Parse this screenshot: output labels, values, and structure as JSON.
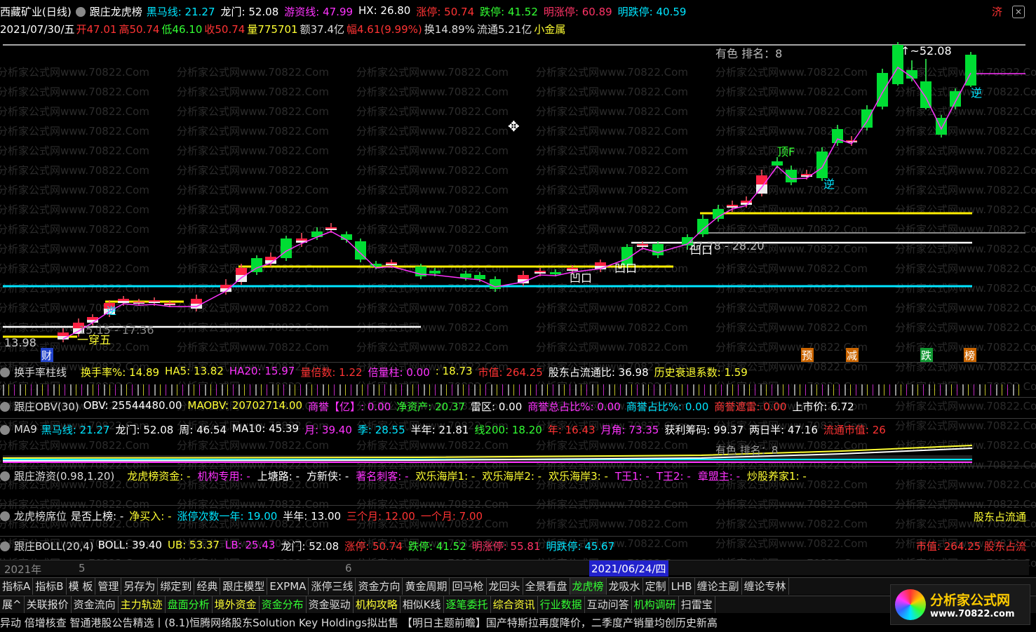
{
  "header": {
    "stock": "西藏矿业(日线)",
    "indicator": "跟庄龙虎榜",
    "items": [
      {
        "t": "黑马线: 21.27",
        "c": "#00e5ff"
      },
      {
        "t": "龙门: 52.08",
        "c": "#ffffff"
      },
      {
        "t": "游资线: 47.99",
        "c": "#ff33ff"
      },
      {
        "t": "HX: 26.80",
        "c": "#ffffff"
      },
      {
        "t": "涨停: 50.74",
        "c": "#ff3333"
      },
      {
        "t": "跌停: 41.52",
        "c": "#33ff33"
      },
      {
        "t": "明涨停: 60.89",
        "c": "#ff3366"
      },
      {
        "t": "明跌停: 40.59",
        "c": "#00e5ff"
      }
    ],
    "corner": "济"
  },
  "info": {
    "date": "2021/07/30/五",
    "items": [
      {
        "t": "开47.01",
        "c": "#ff3333"
      },
      {
        "t": "高50.74",
        "c": "#ff3333"
      },
      {
        "t": "低46.10",
        "c": "#33ff33"
      },
      {
        "t": "收50.74",
        "c": "#ff3333"
      },
      {
        "t": "量775701",
        "c": "#ffff33"
      },
      {
        "t": "额37.4亿",
        "c": "#dddddd"
      },
      {
        "t": "幅4.61(9.99%)",
        "c": "#ff3333"
      },
      {
        "t": "换14.89%",
        "c": "#dddddd"
      },
      {
        "t": "流通5.21亿",
        "c": "#dddddd"
      },
      {
        "t": "小金属",
        "c": "#ffff33"
      }
    ]
  },
  "watermark": "分析家公式网www.70822.Com",
  "chart_labels": {
    "peak": "52.08",
    "rank": "有色    排名：8",
    "range1": "27.78 - 28.20",
    "range2": "15.15 - 17.36",
    "low": "13.98",
    "chuan": "一穿五",
    "top": "顶F",
    "ni1": "逆",
    "ni2": "逆",
    "ni3": "逆",
    "ao1": "凹口",
    "ao2": "凹口",
    "ao3": "凹口",
    "sig_cai": "财",
    "sig_yu": "预",
    "sig_jian": "减",
    "sig_die": "跌",
    "sig_bang": "榜"
  },
  "rows": {
    "turnover": {
      "name": "换手率柱线",
      "items": [
        {
          "t": "换手率%: 14.89",
          "c": "#ffff33"
        },
        {
          "t": "HA5: 13.82",
          "c": "#ffff33"
        },
        {
          "t": "HA20: 15.97",
          "c": "#ff33ff"
        },
        {
          "t": "量倍数: 1.22",
          "c": "#ff3333"
        },
        {
          "t": "倍量柱: 0.00",
          "c": "#ff33ff"
        },
        {
          "t": ": 18.73",
          "c": "#ffff33"
        },
        {
          "t": "市值: 264.25",
          "c": "#ff3333"
        },
        {
          "t": "股东占流通比: 36.98",
          "c": "#ffffff"
        },
        {
          "t": "历史衰退系数: 1.59",
          "c": "#ffff33"
        }
      ]
    },
    "obv": {
      "name": "跟庄OBV(30)",
      "items": [
        {
          "t": "OBV: 25544480.00",
          "c": "#ffffff"
        },
        {
          "t": "MAOBV: 20702714.00",
          "c": "#ffff33"
        },
        {
          "t": "商誉【亿】: 0.00",
          "c": "#ff33ff"
        },
        {
          "t": "净资产: 20.37",
          "c": "#33ff33"
        },
        {
          "t": "雷区: 0.00",
          "c": "#ffffff"
        },
        {
          "t": "商誉总占比%: 0.00",
          "c": "#ff33ff"
        },
        {
          "t": "商誉占比%: 0.00",
          "c": "#00e5ff"
        },
        {
          "t": "商誉遮雷: 0.00",
          "c": "#ff3333"
        },
        {
          "t": "上市价: 6.72",
          "c": "#ffffff"
        }
      ]
    },
    "ma9": {
      "name": "MA9",
      "items": [
        {
          "t": "黑马线: 21.27",
          "c": "#00e5ff"
        },
        {
          "t": "龙门: 52.08",
          "c": "#ffffff"
        },
        {
          "t": "周: 46.54",
          "c": "#ffffff"
        },
        {
          "t": "MA10: 45.39",
          "c": "#ffffff"
        },
        {
          "t": "月: 39.40",
          "c": "#ff33ff"
        },
        {
          "t": "季: 28.55",
          "c": "#00e5ff"
        },
        {
          "t": "半年: 21.81",
          "c": "#ffffff"
        },
        {
          "t": "线200: 18.20",
          "c": "#33ff33"
        },
        {
          "t": "年: 16.43",
          "c": "#ff3333"
        },
        {
          "t": "月角: 73.35",
          "c": "#ff33ff"
        },
        {
          "t": "获利筹码: 99.37",
          "c": "#ffffff"
        },
        {
          "t": "两日半: 47.16",
          "c": "#ffffff"
        },
        {
          "t": "流通市值: 26",
          "c": "#ff3333"
        }
      ]
    },
    "youzi": {
      "name": "跟庄游资(0.98,1.20)",
      "items": [
        {
          "t": "龙虎榜资金: -",
          "c": "#ffff33"
        },
        {
          "t": "机构专用: -",
          "c": "#ff33ff"
        },
        {
          "t": "上塘路: -",
          "c": "#ffffff"
        },
        {
          "t": "方新侠: -",
          "c": "#ffffff"
        },
        {
          "t": "著名刺客: -",
          "c": "#ff33ff"
        },
        {
          "t": "欢乐海岸1: -",
          "c": "#ffff33"
        },
        {
          "t": "欢乐海岸2: -",
          "c": "#ffff33"
        },
        {
          "t": "欢乐海岸3: -",
          "c": "#ffff33"
        },
        {
          "t": "T王1: -",
          "c": "#ff33ff"
        },
        {
          "t": "T王2: -",
          "c": "#ff33ff"
        },
        {
          "t": "章盟主: -",
          "c": "#ff33ff"
        },
        {
          "t": "炒股养家1: -",
          "c": "#ffff33"
        }
      ]
    },
    "lhb": {
      "name": "龙虎榜席位",
      "items": [
        {
          "t": "是否上榜: -",
          "c": "#ffffff"
        },
        {
          "t": "净买入: -",
          "c": "#ffff33"
        },
        {
          "t": "涨停次数一年: 19.00",
          "c": "#00e5ff"
        },
        {
          "t": "半年: 13.00",
          "c": "#ffffff"
        },
        {
          "t": "三个月: 12.00",
          "c": "#ff3333"
        },
        {
          "t": "一个月: 7.00",
          "c": "#ff3333"
        }
      ],
      "right": "股东占流通"
    },
    "boll": {
      "name": "跟庄BOLL(20,4)",
      "items": [
        {
          "t": "BOLL: 39.40",
          "c": "#ffffff"
        },
        {
          "t": "UB: 53.37",
          "c": "#ffff33"
        },
        {
          "t": "LB: 25.43",
          "c": "#ff33ff"
        },
        {
          "t": "龙门: 52.08",
          "c": "#ffffff"
        },
        {
          "t": "涨停: 50.74",
          "c": "#ff3333"
        },
        {
          "t": "跌停: 41.52",
          "c": "#33ff33"
        },
        {
          "t": "明涨停: 55.81",
          "c": "#ff3366"
        },
        {
          "t": "明跌停: 45.67",
          "c": "#00e5ff"
        }
      ],
      "right": "市值: 264.25  股东占流"
    }
  },
  "timeline": {
    "year": "2021年",
    "m5": "5",
    "m6": "6",
    "date": "2021/06/24/四"
  },
  "tabs1": [
    "指标A",
    "指标B",
    "模 板",
    "管理",
    "另存为",
    "绑定到",
    "经典",
    "跟庄模型",
    "EXPMA",
    "涨停三线",
    "资金方向",
    "黄金周期",
    "回马枪",
    "龙回头",
    "全景看盘",
    "龙虎榜",
    "龙吸水",
    "定制",
    "LHB",
    "缠论主副",
    "缠论专林"
  ],
  "tabs1_active": "龙虎榜",
  "tabs2": [
    "展^",
    "关联报价",
    "资金流向",
    "主力轨迹",
    "盘面分析",
    "境外资金",
    "资金分布",
    "资金驱动",
    "机构攻略",
    "相似K线",
    "逐笔委托",
    "综合资讯",
    "行业数据",
    "互动问答",
    "机构调研",
    "扫雷宝"
  ],
  "news": "异动 倍增核查  智通港股公告精选丨(8.1)恒腾网络股东Solution Key Holdings拟出售  【明日主题前瞻】国产特斯拉再度降价，二季度产销量均创历史新高",
  "logo": {
    "name": "分析家公式网",
    "url": "www.70822.com"
  },
  "colors": {
    "up": "#ff3333",
    "down": "#00ee33",
    "cyan": "#00e5ff",
    "yellow": "#ffff33",
    "magenta": "#ff33ff"
  }
}
